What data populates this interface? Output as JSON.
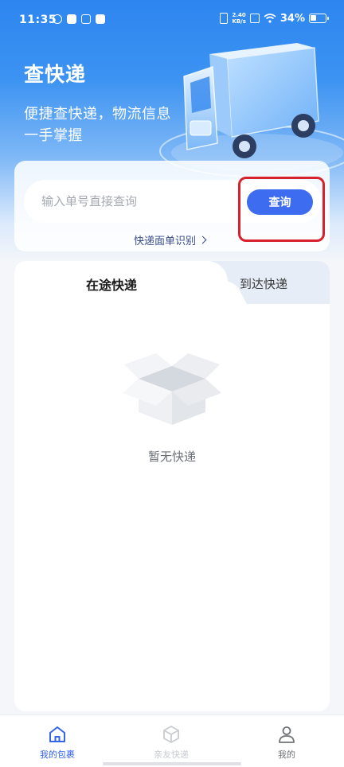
{
  "status_bar": {
    "time": "11:35",
    "net_speed_value": "2.40",
    "net_speed_unit": "KB/s",
    "battery": "34%"
  },
  "header": {
    "title": "查快递",
    "subtitle": "便捷查快递，物流信息一手掌握"
  },
  "search": {
    "placeholder": "输入单号直接查询",
    "value": "",
    "button_label": "查询",
    "scan_link_label": "快递面单识别"
  },
  "tabs": [
    {
      "label": "在途快递",
      "active": true
    },
    {
      "label": "到达快递",
      "active": false
    }
  ],
  "empty_state": {
    "message": "暂无快递",
    "icon": "empty-box-icon"
  },
  "bottom_nav": [
    {
      "label": "我的包裹",
      "icon": "home-icon",
      "active": true
    },
    {
      "label": "亲友快递",
      "icon": "package-icon",
      "active": false
    },
    {
      "label": "我的",
      "icon": "user-icon",
      "active": false
    }
  ],
  "colors": {
    "accent": "#3d6cf0",
    "highlight": "#d7212c",
    "header_gradient_top": "#2d86f0"
  }
}
